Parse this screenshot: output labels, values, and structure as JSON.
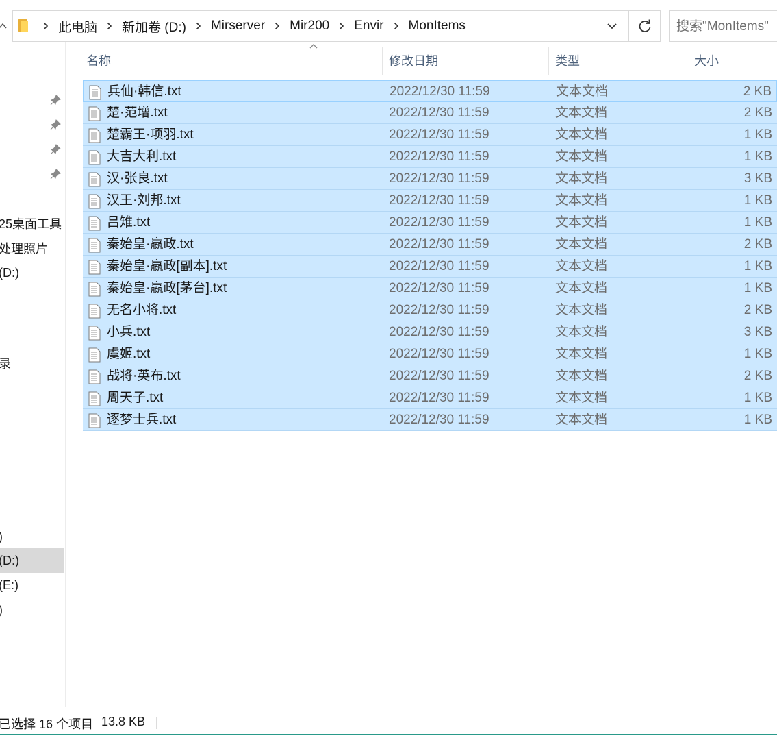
{
  "address": {
    "breadcrumbs": [
      "此电脑",
      "新加卷 (D:)",
      "Mirserver",
      "Mir200",
      "Envir",
      "MonItems"
    ],
    "search_placeholder": "搜索\"MonItems\""
  },
  "nav": {
    "items": [
      "25桌面工具",
      "处理照片",
      "(D:)",
      "录",
      ")",
      "(D:)",
      "(E:)",
      ")"
    ],
    "selected_index": 5
  },
  "columns": {
    "name": "名称",
    "date": "修改日期",
    "type": "类型",
    "size": "大小",
    "sort_column": "name"
  },
  "files": [
    {
      "name": "兵仙·韩信.txt",
      "date": "2022/12/30 11:59",
      "type": "文本文档",
      "size": "2 KB"
    },
    {
      "name": "楚·范增.txt",
      "date": "2022/12/30 11:59",
      "type": "文本文档",
      "size": "2 KB"
    },
    {
      "name": "楚霸王·项羽.txt",
      "date": "2022/12/30 11:59",
      "type": "文本文档",
      "size": "1 KB"
    },
    {
      "name": "大吉大利.txt",
      "date": "2022/12/30 11:59",
      "type": "文本文档",
      "size": "1 KB"
    },
    {
      "name": "汉·张良.txt",
      "date": "2022/12/30 11:59",
      "type": "文本文档",
      "size": "3 KB"
    },
    {
      "name": "汉王·刘邦.txt",
      "date": "2022/12/30 11:59",
      "type": "文本文档",
      "size": "1 KB"
    },
    {
      "name": "吕雉.txt",
      "date": "2022/12/30 11:59",
      "type": "文本文档",
      "size": "1 KB"
    },
    {
      "name": "秦始皇·嬴政.txt",
      "date": "2022/12/30 11:59",
      "type": "文本文档",
      "size": "2 KB"
    },
    {
      "name": "秦始皇·嬴政[副本].txt",
      "date": "2022/12/30 11:59",
      "type": "文本文档",
      "size": "1 KB"
    },
    {
      "name": "秦始皇·嬴政[茅台].txt",
      "date": "2022/12/30 11:59",
      "type": "文本文档",
      "size": "1 KB"
    },
    {
      "name": "无名小将.txt",
      "date": "2022/12/30 11:59",
      "type": "文本文档",
      "size": "2 KB"
    },
    {
      "name": "小兵.txt",
      "date": "2022/12/30 11:59",
      "type": "文本文档",
      "size": "3 KB"
    },
    {
      "name": "虞姬.txt",
      "date": "2022/12/30 11:59",
      "type": "文本文档",
      "size": "1 KB"
    },
    {
      "name": "战将·英布.txt",
      "date": "2022/12/30 11:59",
      "type": "文本文档",
      "size": "2 KB"
    },
    {
      "name": "周天子.txt",
      "date": "2022/12/30 11:59",
      "type": "文本文档",
      "size": "1 KB"
    },
    {
      "name": "逐梦士兵.txt",
      "date": "2022/12/30 11:59",
      "type": "文本文档",
      "size": "1 KB"
    }
  ],
  "status": {
    "selected_text": "已选择 16 个项目",
    "selected_size": "13.8 KB"
  },
  "colors": {
    "selection_bg": "#cce8ff",
    "selection_border": "#99d1ff",
    "header_text": "#4c607a",
    "muted_text": "#6d6d6d",
    "folder_yellow": "#ffd65c"
  }
}
